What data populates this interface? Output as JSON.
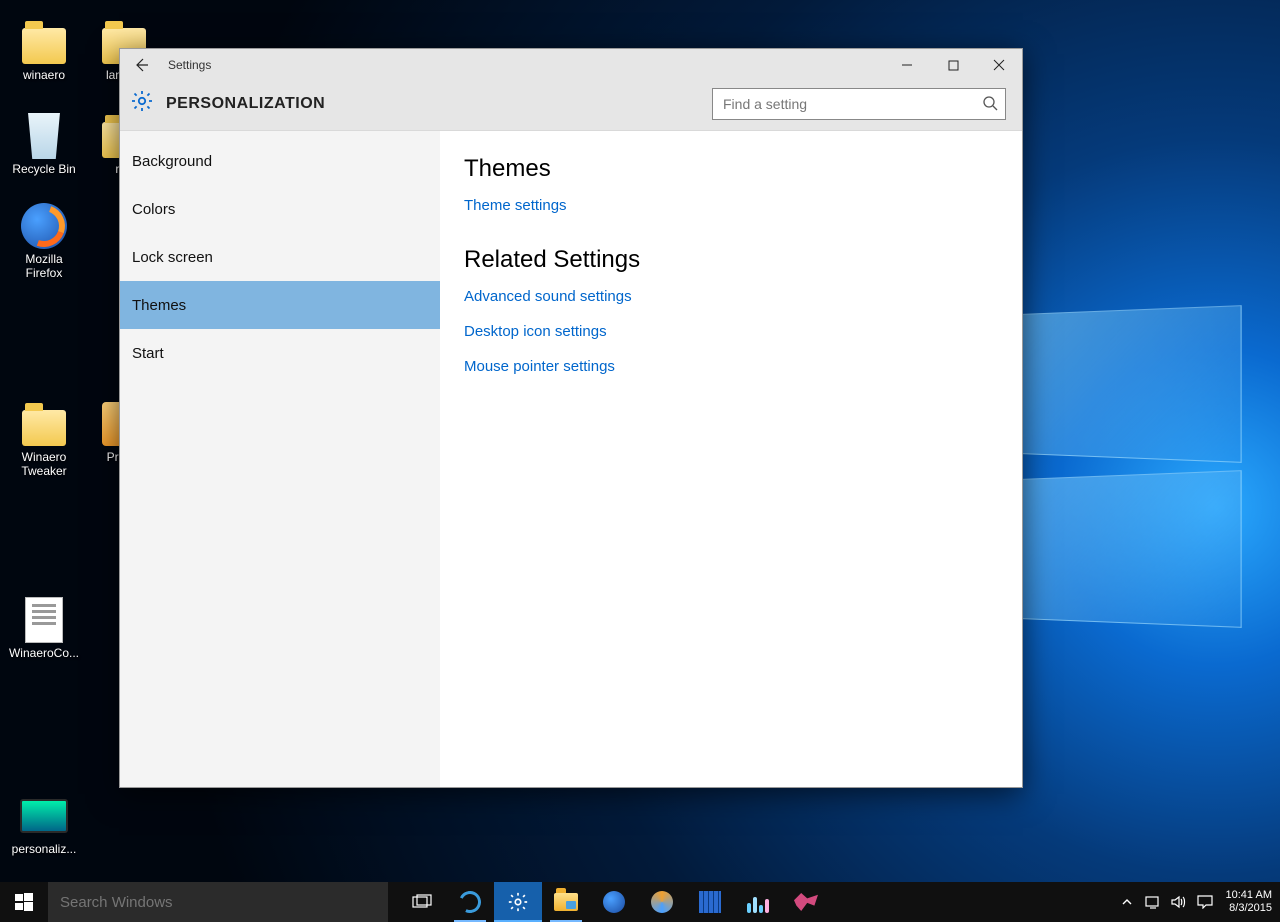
{
  "desktop": {
    "icons": [
      {
        "name": "winaero-folder",
        "label": "winaero",
        "type": "folder"
      },
      {
        "name": "languages-folder",
        "label": "langua",
        "type": "folder"
      },
      {
        "name": "recycle-bin",
        "label": "Recycle Bin",
        "type": "recycle"
      },
      {
        "name": "roe-folder",
        "label": "roe",
        "type": "folder"
      },
      {
        "name": "firefox-app",
        "label": "Mozilla\nFirefox",
        "type": "firefox"
      },
      {
        "name": "winaero-tweaker-folder",
        "label": "Winaero\nTweaker",
        "type": "folder"
      },
      {
        "name": "procmon-app",
        "label": "Procm",
        "type": "app"
      },
      {
        "name": "winaerocontext-doc",
        "label": "WinaeroCo...",
        "type": "doc"
      },
      {
        "name": "personalize-app",
        "label": "personaliz...",
        "type": "monitor"
      }
    ]
  },
  "settings": {
    "window_title": "Settings",
    "page_title": "PERSONALIZATION",
    "search_placeholder": "Find a setting",
    "sidebar_items": [
      {
        "label": "Background",
        "name": "sidebar-item-background",
        "active": false
      },
      {
        "label": "Colors",
        "name": "sidebar-item-colors",
        "active": false
      },
      {
        "label": "Lock screen",
        "name": "sidebar-item-lockscreen",
        "active": false
      },
      {
        "label": "Themes",
        "name": "sidebar-item-themes",
        "active": true
      },
      {
        "label": "Start",
        "name": "sidebar-item-start",
        "active": false
      }
    ],
    "content": {
      "themes_heading": "Themes",
      "theme_settings_link": "Theme settings",
      "related_heading": "Related Settings",
      "related_links": [
        {
          "label": "Advanced sound settings",
          "name": "link-advanced-sound"
        },
        {
          "label": "Desktop icon settings",
          "name": "link-desktop-icons"
        },
        {
          "label": "Mouse pointer settings",
          "name": "link-mouse-pointer"
        }
      ]
    }
  },
  "taskbar": {
    "search_placeholder": "Search Windows",
    "time": "10:41 AM",
    "date": "8/3/2015"
  }
}
